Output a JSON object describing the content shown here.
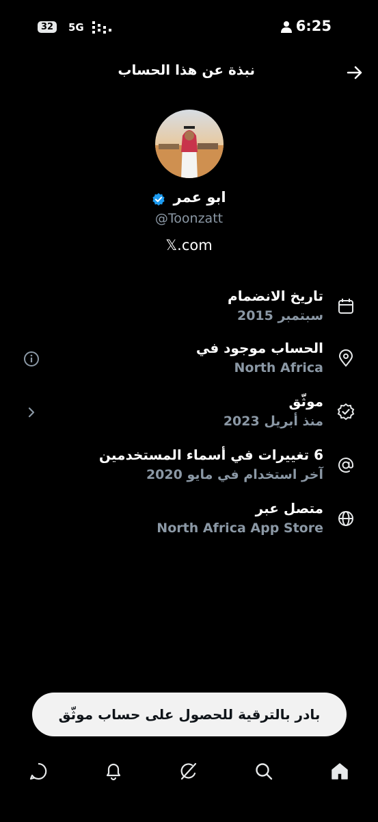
{
  "status_bar": {
    "time": "6:25",
    "battery": "32",
    "network": "5G",
    "person_icon": "person-icon",
    "signal_icon": "signal-icon"
  },
  "header": {
    "title": "نبذة عن هذا الحساب",
    "back_icon": "arrow-right-icon"
  },
  "profile": {
    "name": "ابو عمر",
    "handle": "@Toonzatt",
    "website": "𝕏.com",
    "verified_color": "#1d9bf0"
  },
  "rows": [
    {
      "title": "تاريخ الانضمام",
      "subtitle": "سبتمبر 2015",
      "icon": "calendar-icon"
    },
    {
      "title": "الحساب موجود في",
      "subtitle": "North Africa",
      "icon": "location-pin-icon",
      "left_icon": "info-icon"
    },
    {
      "title": "موثّق",
      "subtitle": "منذ أبريل 2023",
      "icon": "verified-badge-icon",
      "left_icon": "chevron-left-icon"
    },
    {
      "title": "6 تغييرات في أسماء المستخدمين",
      "subtitle": "آخر استخدام في مايو 2020",
      "icon": "at-sign-icon"
    },
    {
      "title": "متصل عبر",
      "subtitle": "North Africa App Store",
      "icon": "globe-icon"
    }
  ],
  "upgrade_button": {
    "label": "بادر بالترقية للحصول على حساب موثّق"
  },
  "bottom_nav": [
    "chat-icon",
    "bell-icon",
    "grok-icon",
    "search-icon",
    "home-icon"
  ]
}
